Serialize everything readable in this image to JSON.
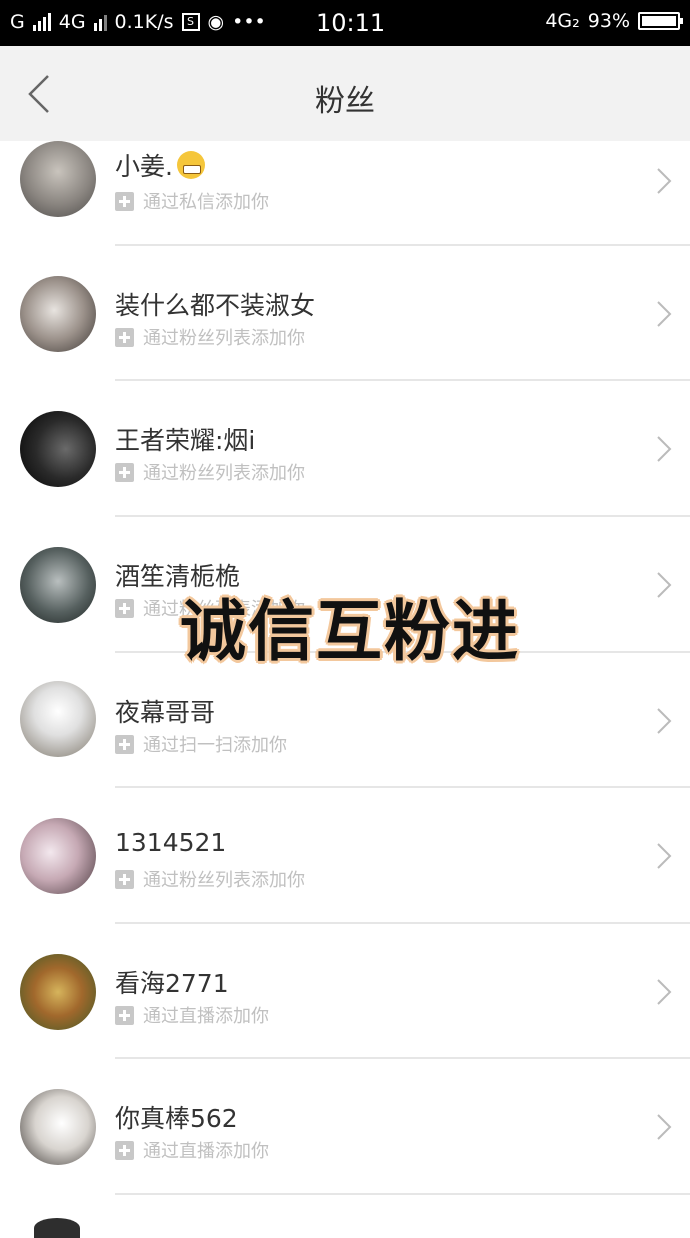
{
  "status_bar": {
    "carrier1": "G",
    "carrier2": "4G",
    "speed": "0.1K/s",
    "sim_icon_label": "S",
    "dots": "•••",
    "time": "10:11",
    "network": "4G₂",
    "battery": "93%"
  },
  "header": {
    "title": "粉丝"
  },
  "overlay_text": "诚信互粉进",
  "fans": [
    {
      "name": "小姜.",
      "source": "通过私信添加你",
      "has_emoji": true
    },
    {
      "name": "装什么都不装淑女",
      "source": "通过粉丝列表添加你"
    },
    {
      "name": "王者荣耀:烟i",
      "source": "通过粉丝列表添加你"
    },
    {
      "name": "酒笙清栀桅",
      "source": "通过粉丝列表添加你"
    },
    {
      "name": "夜幕哥哥",
      "source": "通过扫一扫添加你"
    },
    {
      "name": "1314521",
      "source": "通过粉丝列表添加你"
    },
    {
      "name": "看海2771",
      "source": "通过直播添加你"
    },
    {
      "name": "你真棒562",
      "source": "通过直播添加你"
    }
  ]
}
